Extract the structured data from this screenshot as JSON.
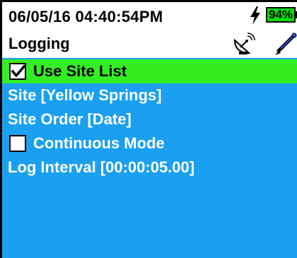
{
  "status_bar": {
    "datetime": "06/05/16 04:40:54PM",
    "battery": "94%",
    "charging_icon": "lightning-bolt-icon",
    "battery_color": "#00e000"
  },
  "header": {
    "title": "Logging",
    "icons": [
      "satellite-dish-icon",
      "probe-pen-icon"
    ]
  },
  "menu": {
    "background": "#1b9ff0",
    "highlight": "#33ee22",
    "items": [
      {
        "label": "Use Site List",
        "checkbox": true,
        "checked": true,
        "selected": true
      },
      {
        "label": "Site [Yellow Springs]"
      },
      {
        "label": "Site Order [Date]"
      },
      {
        "label": "Continuous Mode",
        "checkbox": true,
        "checked": false
      },
      {
        "label": "Log Interval [00:00:05.00]"
      }
    ]
  }
}
